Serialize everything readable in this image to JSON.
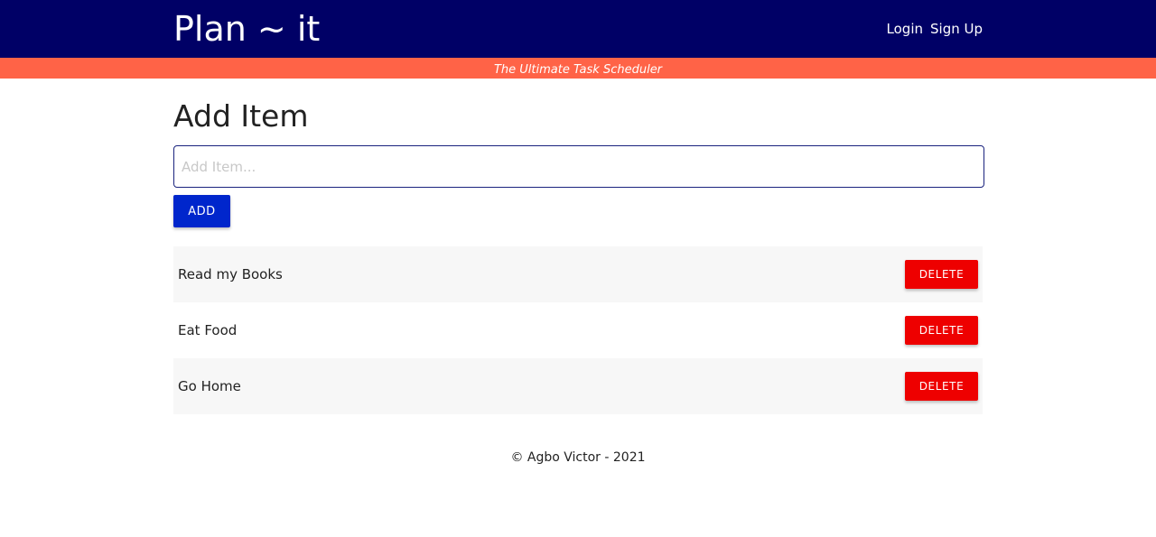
{
  "navbar": {
    "brand": "Plan ~ it",
    "links": [
      {
        "label": "Login"
      },
      {
        "label": "Sign Up"
      }
    ]
  },
  "tagline": "The Ultimate Task Scheduler",
  "main": {
    "title": "Add Item",
    "input": {
      "placeholder": "Add Item...",
      "value": ""
    },
    "add_label": "ADD",
    "items": [
      {
        "text": "Read my Books",
        "delete_label": "DELETE"
      },
      {
        "text": "Eat Food",
        "delete_label": "DELETE"
      },
      {
        "text": "Go Home",
        "delete_label": "DELETE"
      }
    ]
  },
  "footer": {
    "text": "© Agbo Victor - 2021"
  },
  "colors": {
    "navbar_bg": "#000066",
    "tagline_bg": "#ff6347",
    "add_button": "#0026cc",
    "delete_button": "#ee0000",
    "row_shade": "#f7f7f7"
  }
}
